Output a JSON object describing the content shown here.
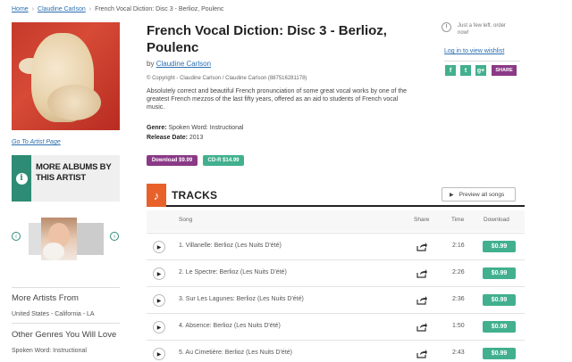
{
  "breadcrumb": {
    "home": "Home",
    "artist": "Claudine Carlson",
    "current": "French Vocal Diction: Disc 3 - Berlioz, Poulenc"
  },
  "album": {
    "title": "French Vocal Diction: Disc 3 - Berlioz, Poulenc",
    "by_label": "by",
    "artist": "Claudine Carlson",
    "copyright": "© Copyright - Claudine Carlson / Claudine Carlson (887516281178)",
    "description": "Absolutely correct and beautiful French pronunciation of some great vocal works by one of the greatest French mezzos of the last fifty years, offered as an aid to students of French vocal music.",
    "genre_label": "Genre:",
    "genre": "Spoken Word: Instructional",
    "release_label": "Release Date:",
    "release": "2013",
    "download_btn": "Download $9.99",
    "cd_btn": "CD-R $14.99"
  },
  "sidebar": {
    "artist_page_link": "Go To Artist Page",
    "more_albums": "More Albums By This Artist",
    "more_artists_heading": "More Artists From",
    "more_artists_location": "United States - California - LA",
    "other_genres_heading": "Other Genres You Will Love",
    "other_genres_item": "Spoken Word: Instructional"
  },
  "right_panel": {
    "notice": "Just a few left. order now!",
    "wishlist_link": "Log in to view wishlist",
    "social": [
      "f",
      "t",
      "g+"
    ],
    "share": "SHARE"
  },
  "tracks": {
    "heading": "TRACKS",
    "preview_all": "Preview all songs",
    "columns": {
      "song": "Song",
      "share": "Share",
      "time": "Time",
      "download": "Download"
    },
    "items": [
      {
        "title": "1. Villanelle: Berlioz (Les Nuits D'été)",
        "time": "2:16",
        "price": "$0.99"
      },
      {
        "title": "2. Le Spectre: Berlioz (Les Nuits D'été)",
        "time": "2:26",
        "price": "$0.99"
      },
      {
        "title": "3. Sur Les Lagunes: Berlioz (Les Nuits D'été)",
        "time": "2:36",
        "price": "$0.99"
      },
      {
        "title": "4. Absence: Berlioz (Les Nuits D'été)",
        "time": "1:50",
        "price": "$0.99"
      },
      {
        "title": "5. Au Cimetière: Berlioz (Les Nuits D'été)",
        "time": "2:43",
        "price": "$0.99"
      }
    ]
  },
  "colors": {
    "accent_green": "#42b08e",
    "accent_purple": "#8a3a86",
    "tracks_orange": "#e8612a",
    "info_teal": "#2e8b74"
  }
}
